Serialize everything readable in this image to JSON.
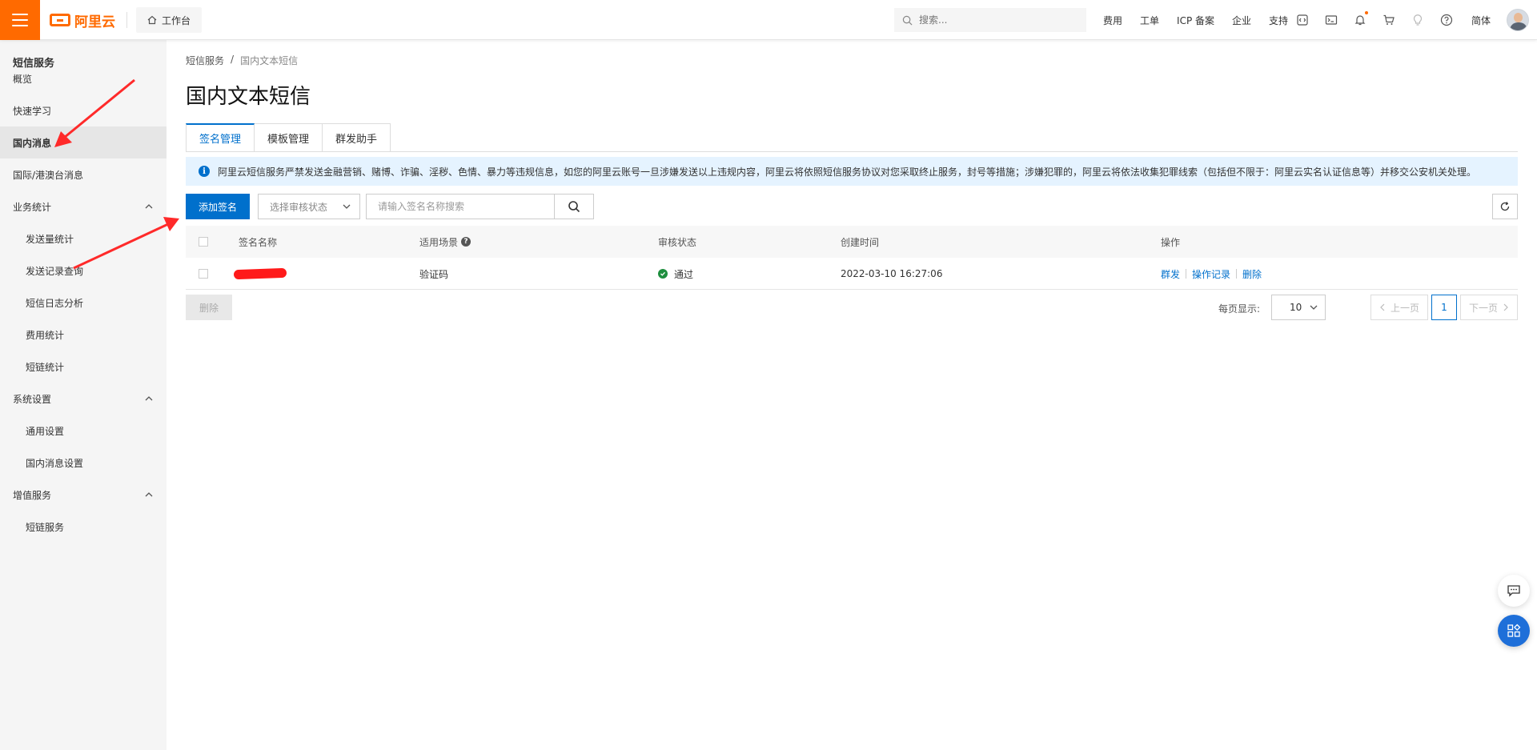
{
  "topbar": {
    "brand": "阿里云",
    "workbench": "工作台",
    "search_placeholder": "搜索...",
    "nav": [
      "费用",
      "工单",
      "ICP 备案",
      "企业",
      "支持"
    ],
    "lang": "简体"
  },
  "sidebar": {
    "title": "短信服务",
    "items": [
      {
        "label": "概览",
        "level": 1
      },
      {
        "label": "快速学习",
        "level": 1
      },
      {
        "label": "国内消息",
        "level": 1,
        "active": true
      },
      {
        "label": "国际/港澳台消息",
        "level": 1
      },
      {
        "label": "业务统计",
        "level": 1,
        "expandable": true
      },
      {
        "label": "发送量统计",
        "level": 2
      },
      {
        "label": "发送记录查询",
        "level": 2
      },
      {
        "label": "短信日志分析",
        "level": 2
      },
      {
        "label": "费用统计",
        "level": 2
      },
      {
        "label": "短链统计",
        "level": 2
      },
      {
        "label": "系统设置",
        "level": 1,
        "expandable": true
      },
      {
        "label": "通用设置",
        "level": 2
      },
      {
        "label": "国内消息设置",
        "level": 2
      },
      {
        "label": "增值服务",
        "level": 1,
        "expandable": true
      },
      {
        "label": "短链服务",
        "level": 2
      }
    ]
  },
  "main": {
    "breadcrumb": [
      "短信服务",
      "国内文本短信"
    ],
    "breadcrumb_sep": "/",
    "title": "国内文本短信",
    "tabs": [
      {
        "label": "签名管理",
        "active": true
      },
      {
        "label": "模板管理"
      },
      {
        "label": "群发助手"
      }
    ],
    "notice": "阿里云短信服务严禁发送金融营销、赌博、诈骗、淫秽、色情、暴力等违规信息，如您的阿里云账号一旦涉嫌发送以上违规内容，阿里云将依照短信服务协议对您采取终止服务，封号等措施；涉嫌犯罪的，阿里云将依法收集犯罪线索（包括但不限于：阿里云实名认证信息等）并移交公安机关处理。",
    "toolbar": {
      "add_label": "添加签名",
      "status_placeholder": "选择审核状态",
      "search_placeholder": "请输入签名名称搜索"
    },
    "table": {
      "columns": [
        "签名名称",
        "适用场景",
        "审核状态",
        "创建时间",
        "操作"
      ],
      "rows": [
        {
          "scene": "验证码",
          "status": "通过",
          "created": "2022-03-10 16:27:06",
          "actions": [
            "群发",
            "操作记录",
            "删除"
          ]
        }
      ]
    },
    "footer": {
      "delete_label": "删除",
      "page_size_label": "每页显示:",
      "page_size": "10",
      "prev": "上一页",
      "next": "下一页",
      "current_page": "1"
    }
  },
  "colors": {
    "brand": "#ff6a00",
    "primary": "#0070cc",
    "annotation": "#ff2a2a"
  }
}
